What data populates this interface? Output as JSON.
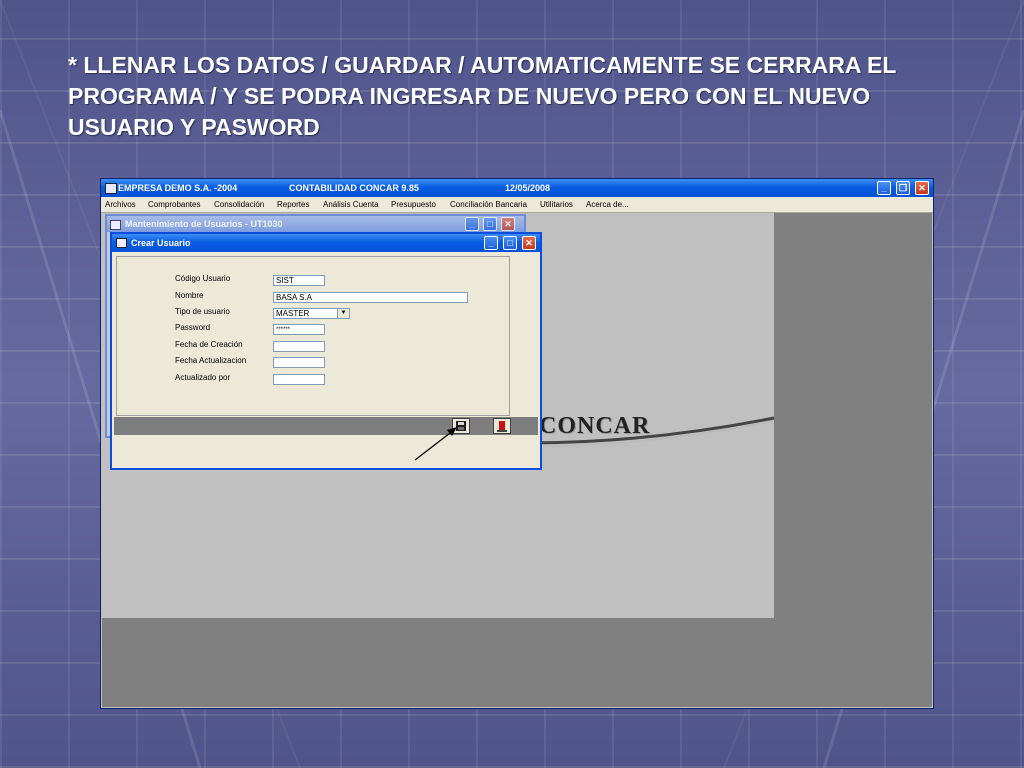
{
  "slide": {
    "title": "* LLENAR LOS DATOS / GUARDAR / AUTOMATICAMENTE SE CERRARA EL PROGRAMA / Y SE PODRA INGRESAR DE NUEVO PERO CON EL NUEVO USUARIO Y PASWORD"
  },
  "app": {
    "company": "EMPRESA DEMO S.A. -2004",
    "module": "CONTABILIDAD CONCAR 9.85",
    "date": "12/05/2008",
    "logo_text": "CONCAR",
    "menu": [
      "Archivos",
      "Comprobantes",
      "Consolidación",
      "Reportes",
      "Análisis Cuenta",
      "Presupuesto",
      "Conciliación Bancaria",
      "Utilitarios",
      "Acerca de..."
    ]
  },
  "back_dialog": {
    "title": "Mantenimiento de Usuarios - UT1030"
  },
  "dialog": {
    "title": "Crear Usuario",
    "fields": [
      {
        "label": "Código Usuario",
        "value": "SIST"
      },
      {
        "label": "Nombre",
        "value": "BASA S.A"
      },
      {
        "label": "Tipo de usuario",
        "value": "MASTER"
      },
      {
        "label": "Password",
        "value": "******"
      },
      {
        "label": "Fecha de Creación",
        "value": ""
      },
      {
        "label": "Fecha Actualizacion",
        "value": ""
      },
      {
        "label": "Actualizado por",
        "value": ""
      }
    ]
  },
  "icons": {
    "save": "floppy-disk-icon",
    "exit": "exit-door-icon",
    "window_minimize": "minimize-icon",
    "window_maximize": "maximize-icon",
    "window_close": "close-icon"
  },
  "colors": {
    "slide_background": "#5a5f94",
    "titlebar_blue": "#0a5ee0",
    "close_red": "#c43a1c"
  }
}
